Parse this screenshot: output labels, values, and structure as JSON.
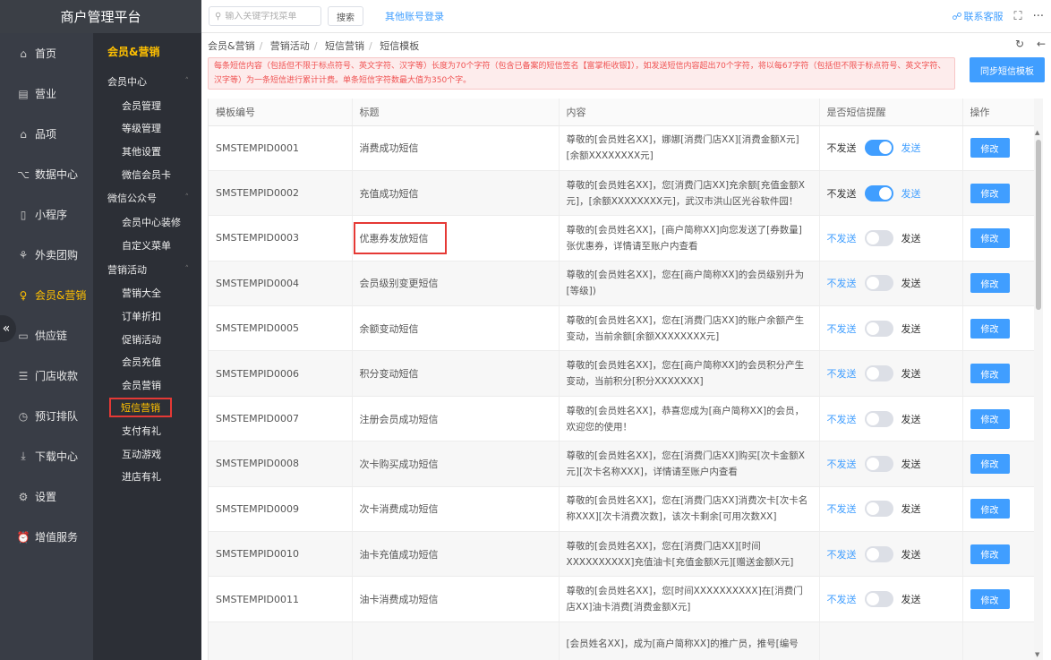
{
  "brand": "商户管理平台",
  "topbar": {
    "search_placeholder": "输入关键字找菜单",
    "search_button": "搜索",
    "other_login": "其他账号登录",
    "contact": "联系客服"
  },
  "nav": [
    {
      "label": "首页",
      "icon": "home-icon",
      "active": false
    },
    {
      "label": "营业",
      "icon": "calendar-icon",
      "active": false
    },
    {
      "label": "品项",
      "icon": "bag-icon",
      "active": false
    },
    {
      "label": "数据中心",
      "icon": "share-icon",
      "active": false
    },
    {
      "label": "小程序",
      "icon": "phone-icon",
      "active": false
    },
    {
      "label": "外卖团购",
      "icon": "bike-icon",
      "active": false
    },
    {
      "label": "会员&营销",
      "icon": "user-icon",
      "active": true
    },
    {
      "label": "供应链",
      "icon": "truck-icon",
      "active": false
    },
    {
      "label": "门店收款",
      "icon": "database-icon",
      "active": false
    },
    {
      "label": "预订排队",
      "icon": "clock-icon",
      "active": false
    },
    {
      "label": "下载中心",
      "icon": "download-icon",
      "active": false
    },
    {
      "label": "设置",
      "icon": "gear-icon",
      "active": false
    },
    {
      "label": "增值服务",
      "icon": "alarm-icon",
      "active": false
    }
  ],
  "subnav": {
    "title": "会员&营销",
    "groups": [
      {
        "label": "会员中心",
        "items": [
          "会员管理",
          "等级管理",
          "其他设置",
          "微信会员卡"
        ]
      },
      {
        "label": "微信公众号",
        "items": [
          "会员中心装修",
          "自定义菜单"
        ]
      },
      {
        "label": "营销活动",
        "items": [
          "营销大全",
          "订单折扣",
          "促销活动",
          "会员充值",
          "会员营销",
          "短信营销",
          "支付有礼",
          "互动游戏",
          "进店有礼"
        ]
      }
    ],
    "active_item": "短信营销"
  },
  "breadcrumb": [
    "会员&营销",
    "营销活动",
    "短信营销",
    "短信模板"
  ],
  "notice": "每条短信内容（包括但不限于标点符号、英文字符、汉字等）长度为70个字符（包含已备案的短信签名【富掌柜收银】），如发送短信内容超出70个字符，将以每67字符（包括但不限于标点符号、英文字符、汉字等）为一条短信进行累计计费。单条短信字符数最大值为350个字。",
  "sync_button": "同步短信模板",
  "table": {
    "headers": [
      "模板编号",
      "标题",
      "内容",
      "是否短信提醒",
      "操作"
    ],
    "off_label": "不发送",
    "on_label": "发送",
    "edit_label": "修改",
    "rows": [
      {
        "id": "SMSTEMPID0001",
        "title": "消费成功短信",
        "content": "尊敬的[会员姓名XX]，娜娜[消费门店XX][消费金额X元][余额XXXXXXXX元]",
        "enabled": true
      },
      {
        "id": "SMSTEMPID0002",
        "title": "充值成功短信",
        "content": "尊敬的[会员姓名XX]，您[消费门店XX]充余额[充值金额X元]，[余额XXXXXXXX元]，武汉市洪山区光谷软件园！",
        "enabled": true
      },
      {
        "id": "SMSTEMPID0003",
        "title": "优惠券发放短信",
        "content": "尊敬的[会员姓名XX]，[商户简称XX]向您发送了[券数量]张优惠券，详情请至账户内查看",
        "enabled": false,
        "highlighted": true
      },
      {
        "id": "SMSTEMPID0004",
        "title": "会员级别变更短信",
        "content": "尊敬的[会员姓名XX]，您在[商户简称XX]的会员级别升为[等级])",
        "enabled": false
      },
      {
        "id": "SMSTEMPID0005",
        "title": "余额变动短信",
        "content": "尊敬的[会员姓名XX]，您在[消费门店XX]的账户余额产生变动，当前余额[余额XXXXXXXX元]",
        "enabled": false
      },
      {
        "id": "SMSTEMPID0006",
        "title": "积分变动短信",
        "content": "尊敬的[会员姓名XX]，您在[商户简称XX]的会员积分产生变动，当前积分[积分XXXXXXX]",
        "enabled": false
      },
      {
        "id": "SMSTEMPID0007",
        "title": "注册会员成功短信",
        "content": "尊敬的[会员姓名XX]，恭喜您成为[商户简称XX]的会员，欢迎您的使用！",
        "enabled": false
      },
      {
        "id": "SMSTEMPID0008",
        "title": "次卡购买成功短信",
        "content": "尊敬的[会员姓名XX]，您在[消费门店XX]购买[次卡金额X元][次卡名称XXX]，详情请至账户内查看",
        "enabled": false
      },
      {
        "id": "SMSTEMPID0009",
        "title": "次卡消费成功短信",
        "content": "尊敬的[会员姓名XX]，您在[消费门店XX]消费次卡[次卡名称XXX][次卡消费次数]，该次卡剩余[可用次数XX]",
        "enabled": false
      },
      {
        "id": "SMSTEMPID0010",
        "title": "油卡充值成功短信",
        "content": "尊敬的[会员姓名XX]，您在[消费门店XX][时间XXXXXXXXXX]充值油卡[充值金额X元][赠送金额X元]",
        "enabled": false
      },
      {
        "id": "SMSTEMPID0011",
        "title": "油卡消费成功短信",
        "content": "尊敬的[会员姓名XX]，您[时间XXXXXXXXXX]在[消费门店XX]油卡消费[消费金额X元]",
        "enabled": false
      },
      {
        "id": "",
        "title": "",
        "content": "[会员姓名XX]，成为[商户简称XX]的推广员，推号[编号",
        "enabled": false
      }
    ]
  },
  "colors": {
    "accent": "#409eff",
    "sidebar": "#393d46",
    "subnav": "#2c2f36",
    "highlight": "#ffc000",
    "annotation": "#e53935"
  }
}
